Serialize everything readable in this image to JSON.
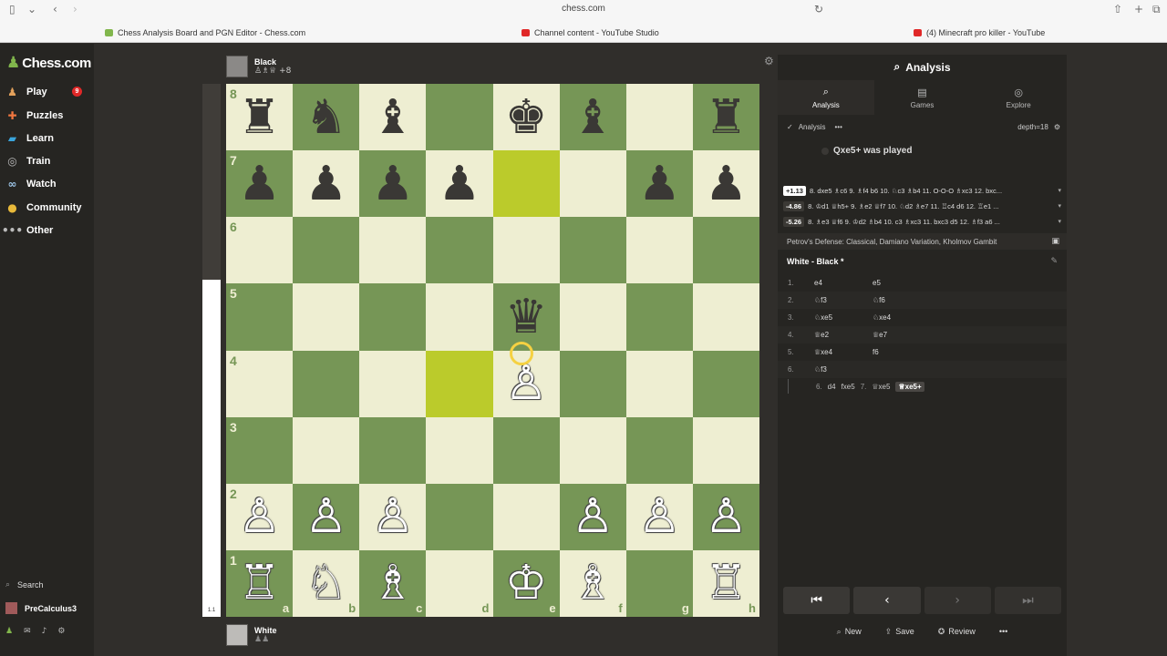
{
  "browser": {
    "url": "chess.com",
    "tabs": [
      {
        "label": "Chess Analysis Board and PGN Editor - Chess.com",
        "color": "#81b64c"
      },
      {
        "label": "Channel content - YouTube Studio",
        "color": "#e02828"
      },
      {
        "label": "(4) Minecraft pro killer - YouTube",
        "color": "#e02828"
      }
    ]
  },
  "sidebar": {
    "logo": "Chess.com",
    "items": [
      {
        "label": "Play",
        "icon": "pawn-icon",
        "badge": "9"
      },
      {
        "label": "Puzzles",
        "icon": "puzzle-icon"
      },
      {
        "label": "Learn",
        "icon": "graduation-icon"
      },
      {
        "label": "Train",
        "icon": "target-icon"
      },
      {
        "label": "Watch",
        "icon": "binoculars-icon"
      },
      {
        "label": "Community",
        "icon": "community-icon"
      },
      {
        "label": "Other",
        "icon": "more-icon"
      }
    ],
    "search": "Search",
    "user": "PreCalculus3"
  },
  "top_player": {
    "name": "Black",
    "captured": "♙♗♕",
    "score": "+8"
  },
  "bottom_player": {
    "name": "White",
    "captured": "♟♟"
  },
  "eval_label": "1.1",
  "board": {
    "ranks": [
      "8",
      "7",
      "6",
      "5",
      "4",
      "3",
      "2",
      "1"
    ],
    "files": [
      "a",
      "b",
      "c",
      "d",
      "e",
      "f",
      "g",
      "h"
    ],
    "highlight": [
      "e7",
      "d4"
    ],
    "pieces": [
      [
        "♜",
        "♞",
        "♝",
        "",
        "♚",
        "♝",
        "",
        "♜"
      ],
      [
        "♟",
        "♟",
        "♟",
        "♟",
        "",
        "",
        "♟",
        "♟"
      ],
      [
        "",
        "",
        "",
        "",
        "",
        "",
        "",
        ""
      ],
      [
        "",
        "",
        "",
        "",
        "♛",
        "",
        "",
        ""
      ],
      [
        "",
        "",
        "",
        "",
        "♙",
        "",
        "",
        ""
      ],
      [
        "",
        "",
        "",
        "",
        "",
        "",
        "",
        ""
      ],
      [
        "♙",
        "♙",
        "♙",
        "",
        "",
        "♙",
        "♙",
        "♙"
      ],
      [
        "♖",
        "♘",
        "♗",
        "",
        "♔",
        "♗",
        "",
        "♖"
      ]
    ]
  },
  "panel": {
    "title": "Analysis",
    "tabs": [
      "Analysis",
      "Games",
      "Explore"
    ],
    "engine_label": "Analysis",
    "depth": "depth=18",
    "played": "Qxe5+ was played",
    "lines": [
      {
        "score": "+1.13",
        "moves": "8. dxe5 ♗c6 9. ♗f4 b6 10. ♘c3 ♗b4 11. O-O-O ♗xc3 12. bxc..."
      },
      {
        "score": "-4.86",
        "moves": "8. ♔d1 ♕h5+ 9. ♗e2 ♕f7 10. ♘d2 ♗e7 11. ♖c4 d6 12. ♖e1 ..."
      },
      {
        "score": "-5.26",
        "moves": "8. ♗e3 ♕f6 9. ♔d2 ♗b4 10. c3 ♗xc3 11. bxc3 d5 12. ♗f3 a6 ..."
      }
    ],
    "opening": "Petrov's Defense: Classical, Damiano Variation, Kholmov Gambit",
    "game_header": "White - Black *",
    "moves": [
      {
        "num": "1.",
        "w": "e4",
        "b": "e5"
      },
      {
        "num": "2.",
        "w": "♘f3",
        "b": "♘f6"
      },
      {
        "num": "3.",
        "w": "♘xe5",
        "b": "♘xe4"
      },
      {
        "num": "4.",
        "w": "♕e2",
        "b": "♕e7"
      },
      {
        "num": "5.",
        "w": "♕xe4",
        "b": "f6"
      },
      {
        "num": "6.",
        "w": "♘f3",
        "b": ""
      }
    ],
    "variation": {
      "num": "6.",
      "m1": "d4",
      "m2": "fxe5",
      "num2": "7.",
      "m3": "♕xe5",
      "m4": "♕xe5+"
    },
    "actions": [
      "New",
      "Save",
      "Review"
    ]
  }
}
